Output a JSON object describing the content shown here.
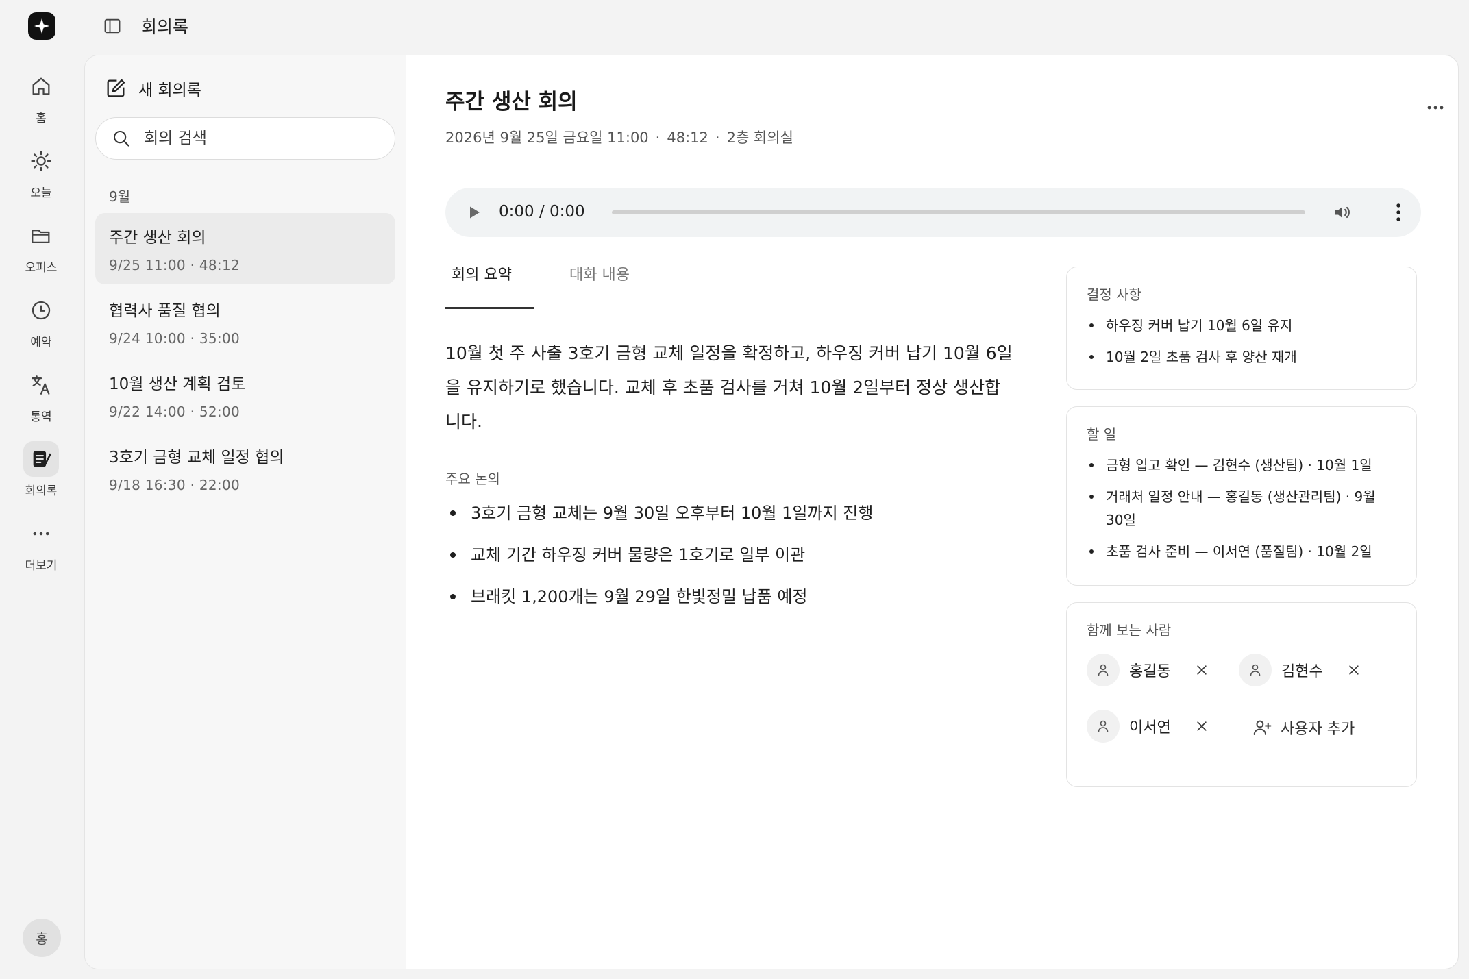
{
  "app": {
    "title": "회의록",
    "avatar_initial": "홍"
  },
  "nav": [
    {
      "label": "홈",
      "icon": "home-icon"
    },
    {
      "label": "오늘",
      "icon": "sun-icon"
    },
    {
      "label": "오피스",
      "icon": "folder-icon"
    },
    {
      "label": "예약",
      "icon": "clock-icon"
    },
    {
      "label": "통역",
      "icon": "translate-icon"
    },
    {
      "label": "회의록",
      "icon": "notes-icon",
      "active": true
    },
    {
      "label": "더보기",
      "icon": "more-horizontal-icon"
    }
  ],
  "list": {
    "new_label": "새 회의록",
    "search_placeholder": "회의 검색",
    "month": "9월",
    "meetings": [
      {
        "title": "주간 생산 회의",
        "meta": "9/25 11:00 · 48:12",
        "active": true
      },
      {
        "title": "협력사 품질 협의",
        "meta": "9/24 10:00 · 35:00"
      },
      {
        "title": "10월 생산 계획 검토",
        "meta": "9/22 14:00 · 52:00"
      },
      {
        "title": "3호기 금형 교체 일정 협의",
        "meta": "9/18 16:30 · 22:00"
      }
    ]
  },
  "detail": {
    "title": "주간 생산 회의",
    "date": "2026년 9월 25일 금요일 11:00",
    "duration": "48:12",
    "location": "2층 회의실",
    "dot": "·",
    "player": {
      "time": "0:00 / 0:00",
      "progress": 0
    },
    "tabs": [
      "회의 요약",
      "대화 내용"
    ],
    "summary": "10월 첫 주 사출 3호기 금형 교체 일정을 확정하고, 하우징 커버 납기 10월 6일을 유지하기로 했습니다. 교체 후 초품 검사를 거쳐 10월 2일부터 정상 생산합니다.",
    "key_points_heading": "주요 논의",
    "key_points": [
      "3호기 금형 교체는 9월 30일 오후부터 10월 1일까지 진행",
      "교체 기간 하우징 커버 물량은 1호기로 일부 이관",
      "브래킷 1,200개는 9월 29일 한빛정밀 납품 예정"
    ]
  },
  "decisions": {
    "heading": "결정 사항",
    "items": [
      "하우징 커버 납기 10월 6일 유지",
      "10월 2일 초품 검사 후 양산 재개"
    ]
  },
  "todos": {
    "heading": "할 일",
    "items": [
      "금형 입고 확인 — 김현수 (생산팀) · 10월 1일",
      "거래처 일정 안내 — 홍길동 (생산관리팀) · 9월 30일",
      "초품 검사 준비 — 이서연 (품질팀) · 10월 2일"
    ]
  },
  "viewers": {
    "heading": "함께 보는 사람",
    "people": [
      "홍길동",
      "김현수",
      "이서연"
    ],
    "add_label": "사용자 추가"
  },
  "colors": {
    "accent": "#1f1f1f",
    "background": "#f3f3f3",
    "player_bg": "#f1f3f4"
  }
}
